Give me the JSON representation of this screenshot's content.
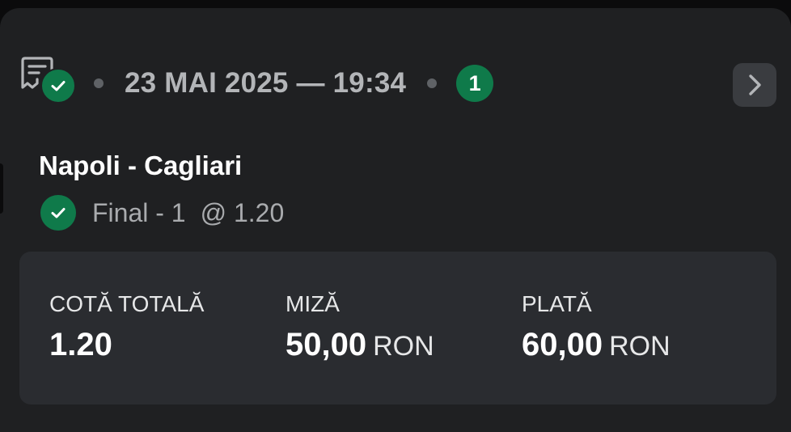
{
  "header": {
    "date_time": "23 MAI 2025 — 19:34",
    "selections_count": "1",
    "receipt_icon": "receipt-icon",
    "status_icon": "check-icon",
    "next_icon": "chevron-right-icon"
  },
  "event": {
    "title": "Napoli - Cagliari",
    "selection": "Final - 1",
    "odds": "@ 1.20",
    "status_icon": "check-icon"
  },
  "summary": {
    "total_odds_label": "COTĂ TOTALĂ",
    "total_odds_value": "1.20",
    "stake_label": "MIZĂ",
    "stake_value": "50,00",
    "stake_currency": "RON",
    "payout_label": "PLATĂ",
    "payout_value": "60,00",
    "payout_currency": "RON"
  },
  "colors": {
    "background": "#1f2022",
    "panel": "#2a2c30",
    "accent_green": "#0f7a4a",
    "muted_text": "#b3b5b8",
    "text": "#ffffff"
  }
}
